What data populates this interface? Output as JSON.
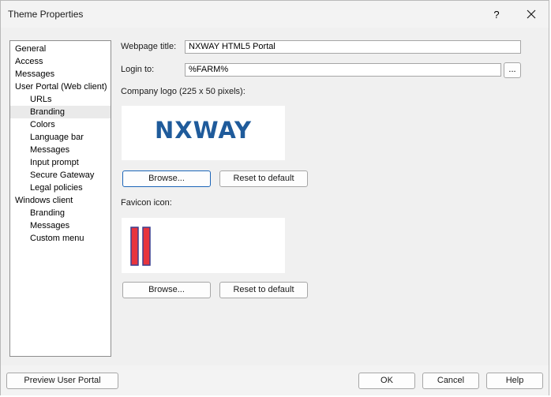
{
  "window": {
    "title": "Theme Properties",
    "help_label": "?",
    "close_icon": "close-icon"
  },
  "tree": {
    "items": [
      {
        "label": "General",
        "level": 0
      },
      {
        "label": "Access",
        "level": 0
      },
      {
        "label": "Messages",
        "level": 0
      },
      {
        "label": "User Portal (Web client)",
        "level": 0
      },
      {
        "label": "URLs",
        "level": 1
      },
      {
        "label": "Branding",
        "level": 1,
        "selected": true
      },
      {
        "label": "Colors",
        "level": 1
      },
      {
        "label": "Language bar",
        "level": 1
      },
      {
        "label": "Messages",
        "level": 1
      },
      {
        "label": "Input prompt",
        "level": 1
      },
      {
        "label": "Secure Gateway",
        "level": 1
      },
      {
        "label": "Legal policies",
        "level": 1
      },
      {
        "label": "Windows client",
        "level": 0
      },
      {
        "label": "Branding",
        "level": 1
      },
      {
        "label": "Messages",
        "level": 1
      },
      {
        "label": "Custom menu",
        "level": 1
      }
    ]
  },
  "form": {
    "webpage_title_label": "Webpage title:",
    "webpage_title_value": "NXWAY HTML5 Portal",
    "login_to_label": "Login to:",
    "login_to_value": "%FARM%",
    "login_browse_label": "...",
    "logo_label": "Company logo (225 x 50 pixels):",
    "logo_text": "NXWAY",
    "logo_color": "#1f5b9b",
    "logo_browse_label": "Browse...",
    "logo_reset_label": "Reset to default",
    "favicon_label": "Favicon icon:",
    "favicon_colors": {
      "fill": "#e8343d",
      "border": "#3a3f8f"
    },
    "favicon_browse_label": "Browse...",
    "favicon_reset_label": "Reset to default"
  },
  "footer": {
    "preview_label": "Preview User Portal",
    "ok_label": "OK",
    "cancel_label": "Cancel",
    "help_label": "Help"
  }
}
